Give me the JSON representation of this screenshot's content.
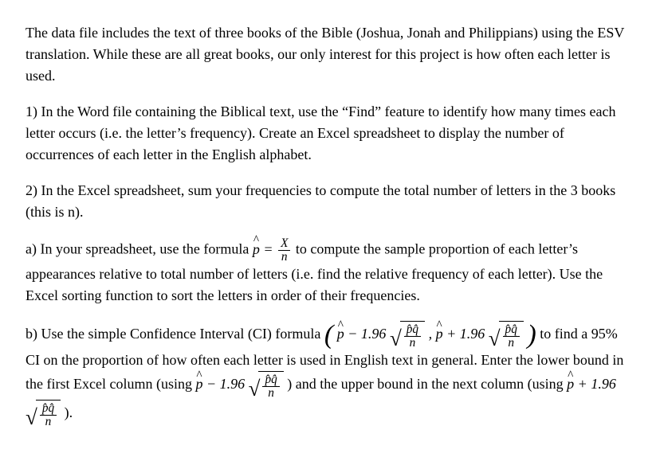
{
  "intro": "The data file includes the text of three books of the Bible (Joshua, Jonah and Philippians) using the ESV translation.  While these are all great books, our only interest for this project is how often each letter is used.",
  "q1": "1) In the Word file containing the Biblical text, use the “Find” feature to identify how many times each letter occurs (i.e. the letter’s frequency).  Create an Excel spreadsheet to display the number of occurrences of each letter in the English alphabet.",
  "q2": "2) In the Excel spreadsheet, sum your frequencies to compute the total number of letters in the 3 books (this is n).",
  "a_pre": "a) In your spreadsheet, use the formula ",
  "a_post": " to compute the sample proportion of each letter’s appearances relative to total number of letters (i.e. find the relative frequency of each letter).  Use the Excel sorting function to sort the letters in order of their frequencies.",
  "b_pre": "b) Use the simple Confidence Interval (CI) formula ",
  "b_mid": " to find a 95% CI on the proportion of how often each letter is used in English text in general.  Enter the lower bound in the first Excel column (using ",
  "b_mid2": " ) and the upper bound in the next column (using ",
  "b_end": " ).",
  "sym": {
    "phat": "p",
    "eq": " = ",
    "X": "X",
    "n": "n",
    "minus": " − 1.96",
    "plus": " + 1.96",
    "comma": " , ",
    "pq": "p̂q̂"
  }
}
